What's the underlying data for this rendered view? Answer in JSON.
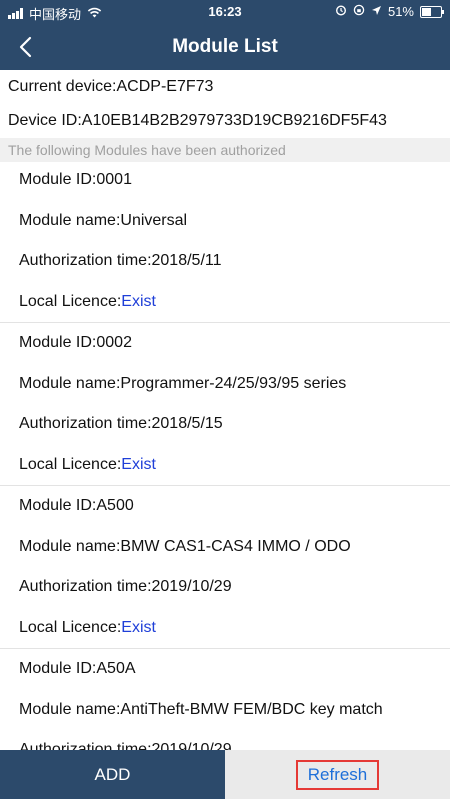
{
  "statusbar": {
    "carrier": "中国移动",
    "time": "16:23",
    "battery": "51%",
    "battery_level": 0.51
  },
  "navbar": {
    "title": "Module List"
  },
  "info": {
    "current_device": "Current device:ACDP-E7F73",
    "device_id": "Device ID:A10EB14B2B2979733D19CB9216DF5F43",
    "section_header": "The following Modules have been authorized"
  },
  "modules": [
    {
      "id": "Module ID:0001",
      "name": "Module name:Universal",
      "time": "Authorization time:2018/5/11",
      "licence_label": "Local Licence:",
      "licence_value": "Exist"
    },
    {
      "id": "Module ID:0002",
      "name": "Module name:Programmer-24/25/93/95 series",
      "time": "Authorization time:2018/5/15",
      "licence_label": "Local Licence:",
      "licence_value": "Exist"
    },
    {
      "id": "Module ID:A500",
      "name": "Module name:BMW CAS1-CAS4 IMMO / ODO",
      "time": "Authorization time:2019/10/29",
      "licence_label": "Local Licence:",
      "licence_value": "Exist"
    },
    {
      "id": "Module ID:A50A",
      "name": "Module name:AntiTheft-BMW FEM/BDC key match",
      "time": "Authorization time:2019/10/29"
    }
  ],
  "footer": {
    "add_label": "ADD",
    "refresh_label": "Refresh"
  },
  "colors": {
    "header_bg": "#2c4a6b",
    "link": "#1f3fd8",
    "refresh_text": "#1e6fd9",
    "highlight_border": "#e53935"
  }
}
